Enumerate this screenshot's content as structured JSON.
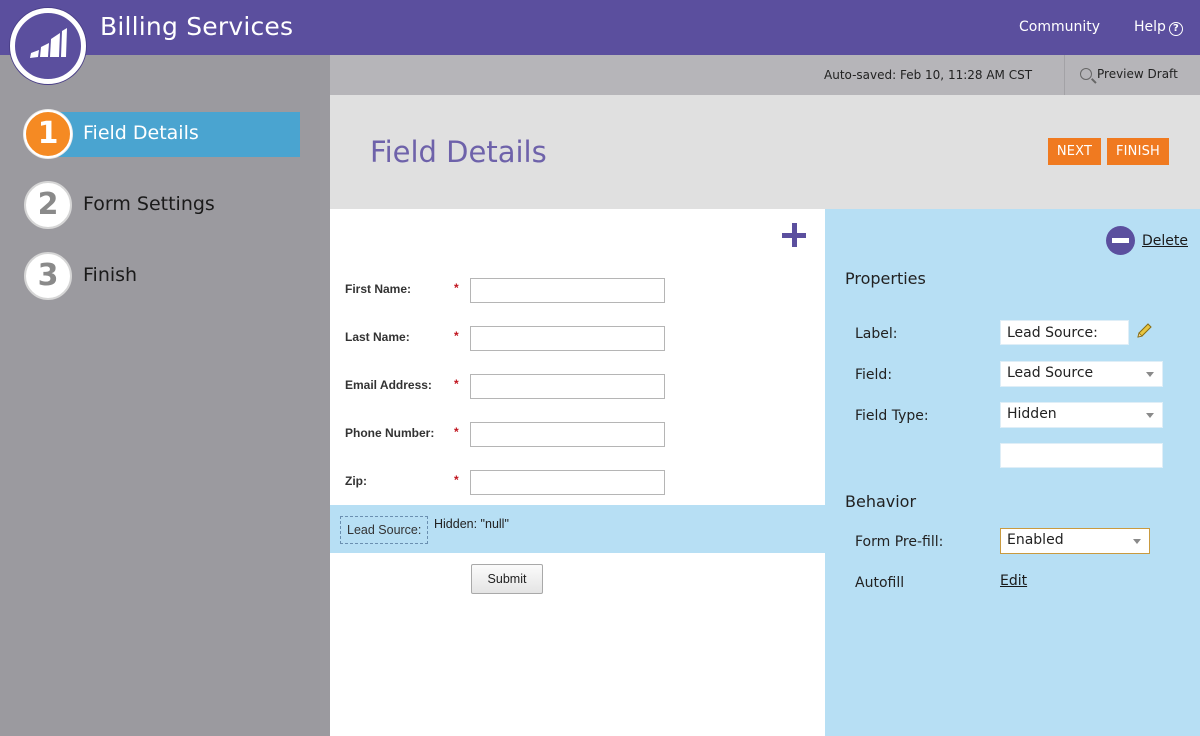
{
  "app": {
    "title": "Billing Services"
  },
  "topnav": {
    "community": "Community",
    "help": "Help",
    "help_icon": "?"
  },
  "steps": [
    {
      "number": "1",
      "label": "Field Details"
    },
    {
      "number": "2",
      "label": "Form Settings"
    },
    {
      "number": "3",
      "label": "Finish"
    }
  ],
  "savebar": {
    "autosave": "Auto-saved: Feb 10, 11:28 AM CST",
    "preview": "Preview Draft"
  },
  "header": {
    "title": "Field Details",
    "next": "NEXT",
    "finish": "FINISH"
  },
  "form": {
    "fields": [
      {
        "label": "First Name:",
        "required": "*",
        "value": ""
      },
      {
        "label": "Last Name:",
        "required": "*",
        "value": ""
      },
      {
        "label": "Email Address:",
        "required": "*",
        "value": ""
      },
      {
        "label": "Phone Number:",
        "required": "*",
        "value": ""
      },
      {
        "label": "Zip:",
        "required": "*",
        "value": ""
      }
    ],
    "hidden_field": {
      "label": "Lead Source:",
      "value": "Hidden: \"null\""
    },
    "submit": "Submit"
  },
  "properties": {
    "delete": "Delete",
    "heading": "Properties",
    "label_label": "Label:",
    "label_value": "Lead Source:",
    "field_label": "Field:",
    "field_value": "Lead Source",
    "field_type_label": "Field Type:",
    "field_type_value": "Hidden",
    "default_value": ""
  },
  "behavior": {
    "heading": "Behavior",
    "prefill_label": "Form Pre-fill:",
    "prefill_value": "Enabled",
    "autofill_label": "Autofill",
    "autofill_edit": "Edit"
  },
  "colors": {
    "brand": "#5b4f9e",
    "accent_orange": "#f07a20",
    "active_step": "#4aa4d0",
    "panel_blue": "#b7dff4"
  }
}
